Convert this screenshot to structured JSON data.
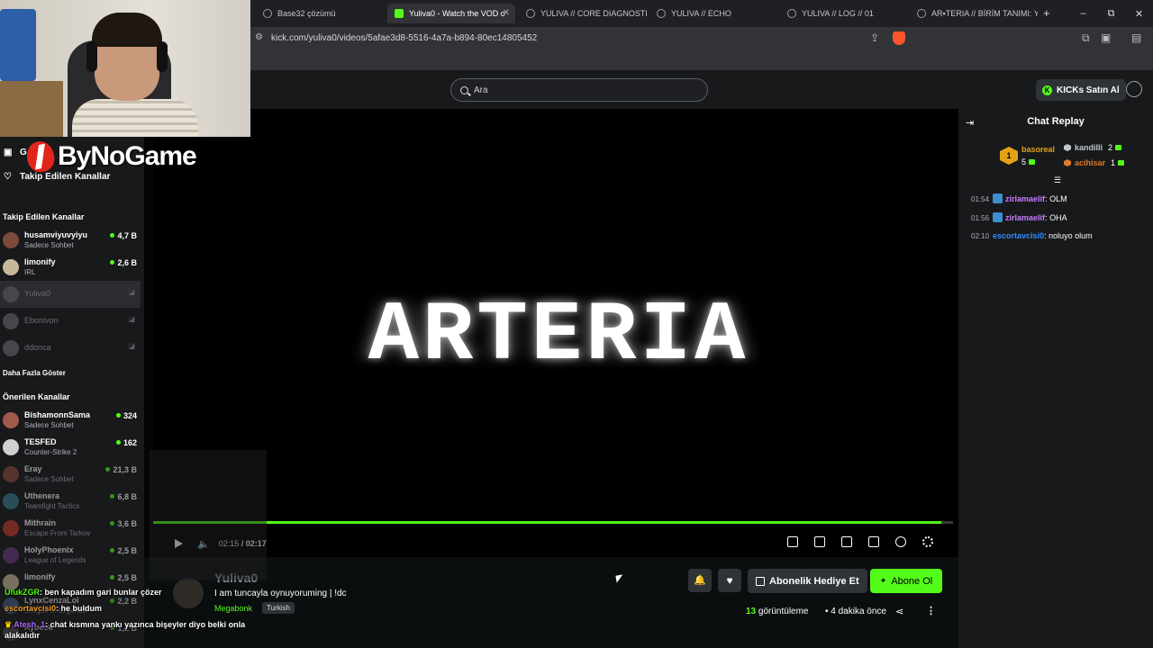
{
  "browser": {
    "tabs": [
      {
        "title": "Base32 çözümü",
        "active": false
      },
      {
        "title": "Yuliva0 - Watch the VOD o",
        "active": true
      },
      {
        "title": "YULIVA // CORE DIAGNOSTIC",
        "active": false
      },
      {
        "title": "YULIVA // ECHO",
        "active": false
      },
      {
        "title": "YULIVA // LOG // 01",
        "active": false
      },
      {
        "title": "AR▪TERIA // BİRİM TANIMI: YU",
        "active": false
      }
    ],
    "url": "kick.com/yuliva0/videos/5afae3d8-5516-4a7a-b894-80ec14805452",
    "new_tab_glyph": "+",
    "window_controls": [
      "–",
      "⧉",
      "✕"
    ]
  },
  "overlay": {
    "logo_text": "ByNoGame"
  },
  "header": {
    "search_placeholder": "Ara",
    "kicks_label": "KICKs Satın Al"
  },
  "sidebar": {
    "nav": [
      {
        "label": "G",
        "icon": "browse-icon"
      },
      {
        "label": "Takip Edilen Kanallar",
        "icon": "heart-icon"
      }
    ],
    "followed_title": "Takip Edilen Kanallar",
    "followed": [
      {
        "name": "husamviyuvyiyu",
        "sub": "Sadece Sohbet",
        "count": "4,7 B",
        "live": true
      },
      {
        "name": "limonify",
        "sub": "IRL",
        "count": "2,6 B",
        "live": true
      },
      {
        "name": "Yuliva0",
        "sub": "",
        "count": "",
        "live": false
      },
      {
        "name": "Ebonivon",
        "sub": "",
        "count": "",
        "live": false
      },
      {
        "name": "ddonca",
        "sub": "",
        "count": "",
        "live": false
      }
    ],
    "show_more": "Daha Fazla Göster",
    "recommended_title": "Önerilen Kanallar",
    "recommended": [
      {
        "name": "BishamonnSama",
        "sub": "Sadece Sohbet",
        "count": "324"
      },
      {
        "name": "TESFED",
        "sub": "Counter-Strike 2",
        "count": "162"
      },
      {
        "name": "Eray",
        "sub": "Sadece Sohbet",
        "count": "21,3 B"
      },
      {
        "name": "Uthenera",
        "sub": "Teamfight Tactics",
        "count": "6,8 B"
      },
      {
        "name": "Mithrain",
        "sub": "Escape From Tarkov",
        "count": "3,6 B"
      },
      {
        "name": "HolyPhoenix",
        "sub": "League of Legends",
        "count": "2,5 B"
      },
      {
        "name": "limonify",
        "sub": "",
        "count": "2,5 B"
      },
      {
        "name": "LynxCenzaLol",
        "sub": "League of Legends",
        "count": "2,2 B"
      },
      {
        "name": "Aybeck",
        "sub": "",
        "count": "1,2 B"
      }
    ]
  },
  "player": {
    "title_card": "ARTERIA",
    "current_time": "02:15",
    "separator": " / ",
    "duration": "02:17",
    "progress": 0.985
  },
  "chat": {
    "title": "Chat Replay",
    "leaderboard": {
      "first": {
        "rank": "1",
        "name": "basoreal",
        "count": "5"
      },
      "others": [
        {
          "name": "kandilli",
          "count": "2",
          "color": "#c0c4cc"
        },
        {
          "name": "acihisar",
          "count": "1",
          "color": "#e07a2e"
        }
      ]
    },
    "messages": [
      {
        "time": "01:54",
        "user": "zirlamaelif",
        "text": ": OLM",
        "color": "#c77dff",
        "badge": true
      },
      {
        "time": "01:56",
        "user": "zirlamaelif",
        "text": ": OHA",
        "color": "#c77dff",
        "badge": true
      },
      {
        "time": "02:10",
        "user": "escortavcisi0",
        "text": ": noluyo olum",
        "color": "#2f8cff",
        "badge": false
      }
    ]
  },
  "channel": {
    "name": "Yuliva0",
    "stream_title": "I am tuncayla oynuyoruming | !dc",
    "category": "Megabonk",
    "language": "Turkish",
    "gift_label": "Abonelik Hediye Et",
    "subscribe_label": "Abone Ol",
    "views_count": "13",
    "views_label": " görüntüleme",
    "ago": "4 dakika önce"
  },
  "overlay_chat": [
    {
      "user": "UfukZGR",
      "text": ": ben kapadım gari bunlar çözer",
      "cls": "u1"
    },
    {
      "user": "escortavcisi0",
      "text": ": he buldum",
      "cls": "u2"
    },
    {
      "user": "Atesh_1",
      "text": ": chat kısmına yankı yazınca bişeyler diyo belki onla alakalıdır",
      "cls": "u3"
    }
  ],
  "colors": {
    "kick_green": "#53fc18",
    "background": "#0b0e0f",
    "panel": "#18191b"
  }
}
